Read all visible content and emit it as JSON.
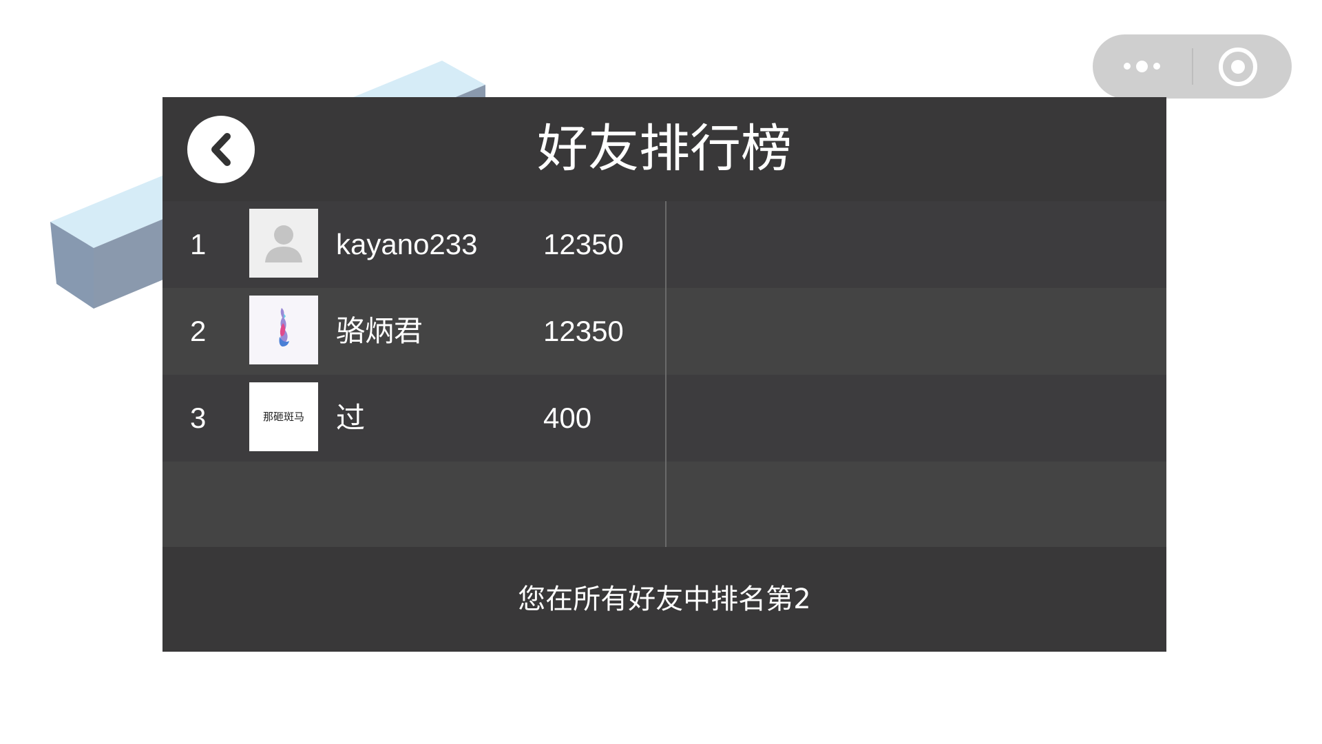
{
  "window": {
    "capsule": {
      "more_icon": "more-dots-icon",
      "close_icon": "target-close-icon"
    }
  },
  "leaderboard": {
    "title": "好友排行榜",
    "back_icon": "chevron-left-icon",
    "entries": [
      {
        "rank": "1",
        "name": "kayano233",
        "score": "12350",
        "avatar": "default-person-avatar"
      },
      {
        "rank": "2",
        "name": "骆炳君",
        "score": "12350",
        "avatar": "illustration-avatar"
      },
      {
        "rank": "3",
        "name": "过",
        "score": "400",
        "avatar": "text-avatar",
        "avatar_text": "那砸斑马"
      }
    ],
    "footer": "您在所有好友中排名第2"
  },
  "colors": {
    "panel_bg": "#393839",
    "row_odd": "#3d3c3e",
    "row_even": "#444444",
    "text": "#ffffff",
    "capsule_bg": "#cfcfcf",
    "block_top": "#d6ecf7",
    "block_side": "#8a99ad"
  }
}
